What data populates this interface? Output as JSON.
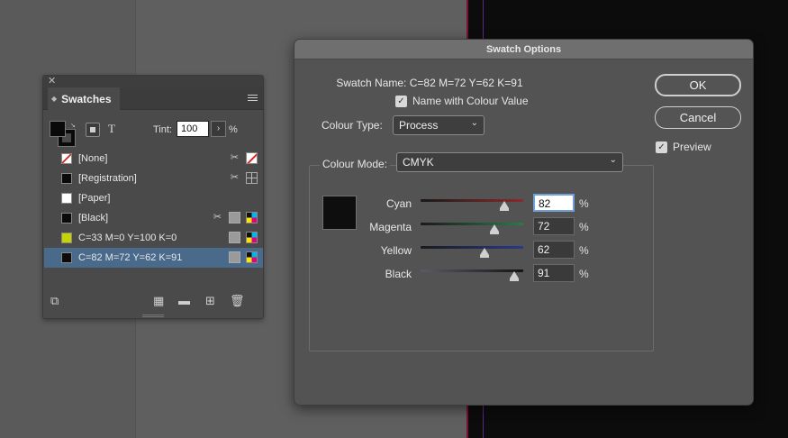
{
  "swatches_panel": {
    "tab_label": "Swatches",
    "tint_label": "Tint:",
    "tint_value": "100",
    "tint_unit": "%",
    "text_mode_glyph": "T",
    "rows": [
      {
        "name": "[None]",
        "chip": "#ffffff",
        "icons": [
          "no-delete-icon",
          "none-swatch-icon"
        ]
      },
      {
        "name": "[Registration]",
        "chip": "#0a0a0a",
        "icons": [
          "no-delete-icon",
          "registration-icon"
        ]
      },
      {
        "name": "[Paper]",
        "chip": "#ffffff",
        "icons": []
      },
      {
        "name": "[Black]",
        "chip": "#0a0a0a",
        "icons": [
          "no-delete-icon",
          "process-icon",
          "cmyk-icon"
        ]
      },
      {
        "name": "C=33 M=0 Y=100 K=0",
        "chip": "#c8d400",
        "icons": [
          "process-icon",
          "cmyk-icon"
        ]
      },
      {
        "name": "C=82 M=72 Y=62 K=91",
        "chip": "#0c0c0c",
        "icons": [
          "process-icon",
          "cmyk-icon"
        ],
        "selected": true
      }
    ]
  },
  "dialog": {
    "title": "Swatch Options",
    "swatch_name_label": "Swatch Name:",
    "swatch_name_value": "C=82 M=72 Y=62 K=91",
    "name_with_colour_value_label": "Name with Colour Value",
    "name_with_colour_value_checked": true,
    "colour_type_label": "Colour Type:",
    "colour_type_value": "Process",
    "colour_mode_label": "Colour Mode:",
    "colour_mode_value": "CMYK",
    "ok_label": "OK",
    "cancel_label": "Cancel",
    "preview_label": "Preview",
    "preview_checked": true,
    "preview_color": "#0e0e0e",
    "channels": [
      {
        "label": "Cyan",
        "value": 82,
        "unit": "%",
        "gradient": [
          "#1a1a1a",
          "#8a2a2a"
        ],
        "focused": true
      },
      {
        "label": "Magenta",
        "value": 72,
        "unit": "%",
        "gradient": [
          "#1a1a1a",
          "#2a7a4a"
        ]
      },
      {
        "label": "Yellow",
        "value": 62,
        "unit": "%",
        "gradient": [
          "#1a1a1a",
          "#2a3a8a"
        ]
      },
      {
        "label": "Black",
        "value": 91,
        "unit": "%",
        "gradient": [
          "#5a5a6a",
          "#141414"
        ]
      }
    ]
  }
}
